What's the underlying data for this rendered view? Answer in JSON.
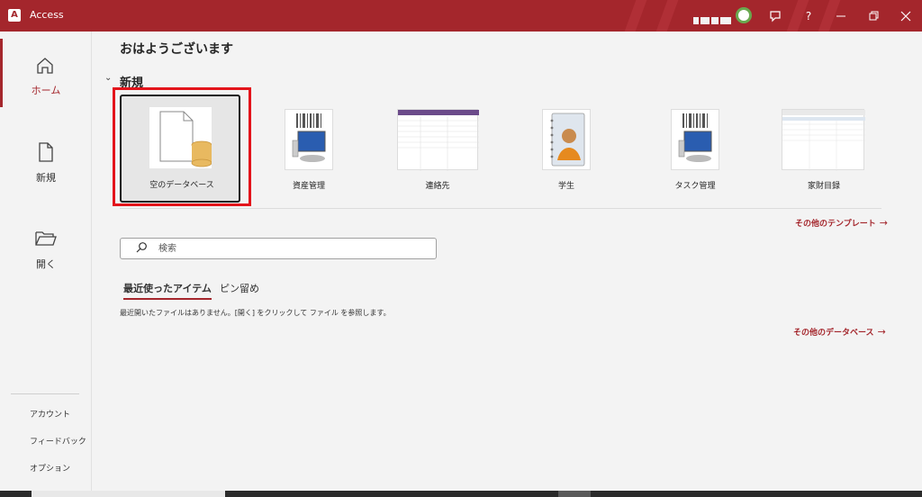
{
  "titlebar": {
    "app_name": "Access",
    "accent": "#a4262c",
    "icons": [
      "feedback-icon",
      "help-icon",
      "minimize-icon",
      "restore-icon",
      "close-icon"
    ],
    "help_glyph": "?"
  },
  "rail": {
    "items": [
      {
        "label": "ホーム",
        "icon": "home-icon"
      },
      {
        "label": "新規",
        "icon": "new-document-icon"
      },
      {
        "label": "開く",
        "icon": "open-folder-icon"
      }
    ],
    "links": [
      "アカウント",
      "フィードバック",
      "オプション"
    ]
  },
  "main": {
    "greeting": "おはようございます",
    "new_section_title": "新規",
    "templates": [
      {
        "label": "空のデータベース",
        "selected": true
      },
      {
        "label": "資産管理"
      },
      {
        "label": "連絡先"
      },
      {
        "label": "学生"
      },
      {
        "label": "タスク管理"
      },
      {
        "label": "家財目録"
      }
    ],
    "more_templates": "その他のテンプレート",
    "search_placeholder": "検索",
    "tabs": [
      "最近使ったアイテム",
      "ピン留め"
    ],
    "empty_message": "最近開いたファイルはありません。[開く] をクリックして ファイル を参照します。",
    "more_databases": "その他のデータベース"
  }
}
